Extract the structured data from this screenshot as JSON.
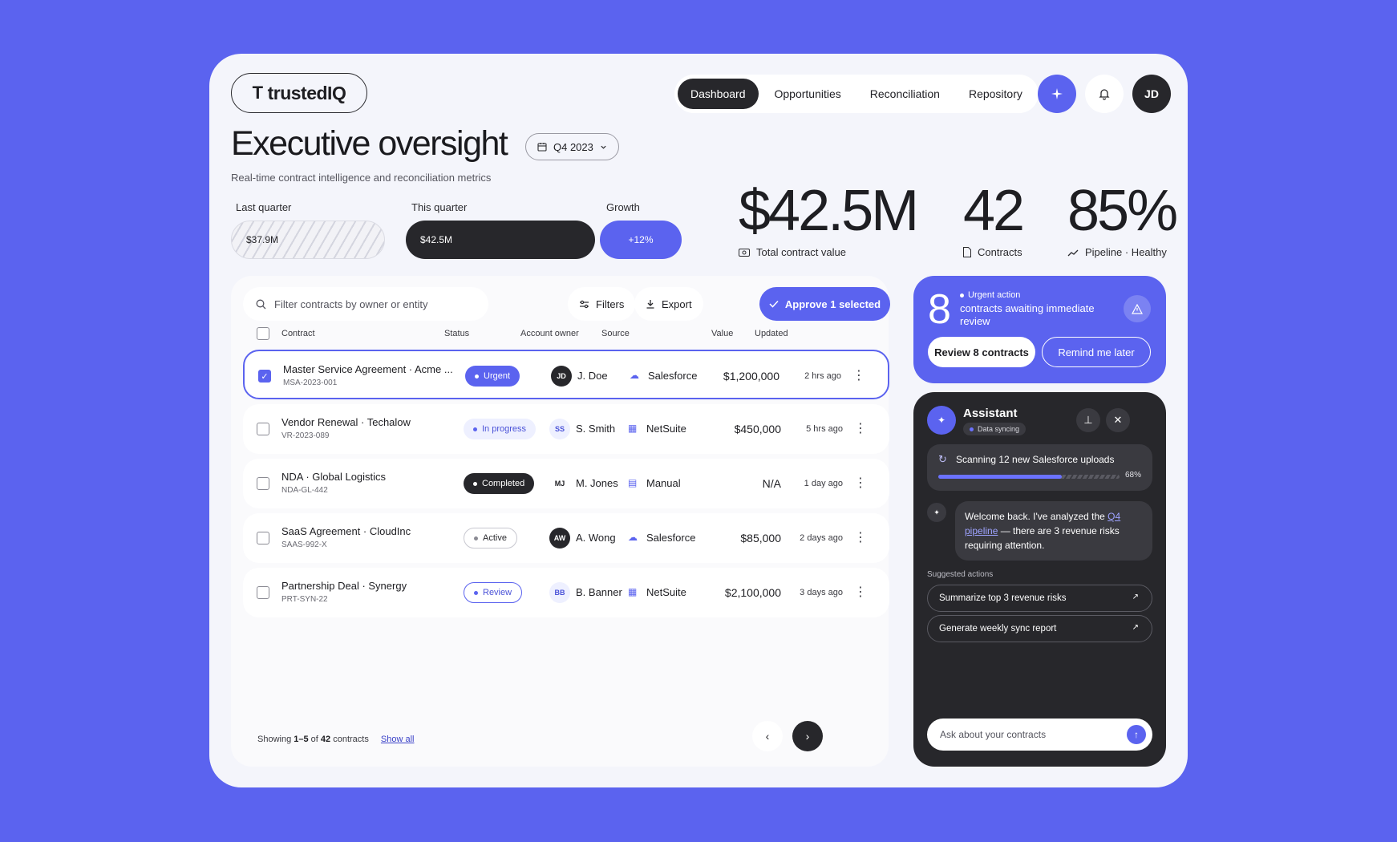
{
  "brand": {
    "logo_mark": "T",
    "logo_text": "trustedIQ"
  },
  "nav": {
    "items": [
      "Dashboard",
      "Opportunities",
      "Reconciliation",
      "Repository"
    ],
    "active": "Dashboard"
  },
  "header": {
    "avatar_initials": "JD"
  },
  "page": {
    "title": "Executive oversight",
    "quarter": "Q4 2023",
    "subtitle": "Real-time contract intelligence and reconciliation metrics"
  },
  "comparison": {
    "last_label": "Last quarter",
    "last_value": "$37.9M",
    "this_label": "This quarter",
    "this_value": "$42.5M",
    "growth_label": "Growth",
    "growth_value": "+12%"
  },
  "stats": {
    "total_value": "$42.5M",
    "total_label": "Total contract value",
    "contracts": "42",
    "contracts_label": "Contracts",
    "pipeline": "85%",
    "pipeline_label": "Pipeline · Healthy"
  },
  "table": {
    "search_placeholder": "Filter contracts by owner or entity",
    "filters_label": "Filters",
    "export_label": "Export",
    "approve_label": "Approve 1 selected",
    "columns": {
      "contract": "Contract",
      "status": "Status",
      "owner": "Account owner",
      "source": "Source",
      "value": "Value",
      "updated": "Updated"
    },
    "rows": [
      {
        "name": "Master Service Agreement · Acme ...",
        "code": "MSA-2023-001",
        "status": "Urgent",
        "owner_initials": "JD",
        "owner": "J. Doe",
        "source": "Salesforce",
        "value": "$1,200,000",
        "updated": "2 hrs ago"
      },
      {
        "name": "Vendor Renewal · Techalow",
        "code": "VR-2023-089",
        "status": "In progress",
        "owner_initials": "SS",
        "owner": "S. Smith",
        "source": "NetSuite",
        "value": "$450,000",
        "updated": "5 hrs ago"
      },
      {
        "name": "NDA · Global Logistics",
        "code": "NDA-GL-442",
        "status": "Completed",
        "owner_initials": "MJ",
        "owner": "M. Jones",
        "source": "Manual",
        "value": "N/A",
        "updated": "1 day ago"
      },
      {
        "name": "SaaS Agreement · CloudInc",
        "code": "SAAS-992-X",
        "status": "Active",
        "owner_initials": "AW",
        "owner": "A. Wong",
        "source": "Salesforce",
        "value": "$85,000",
        "updated": "2 days ago"
      },
      {
        "name": "Partnership Deal · Synergy",
        "code": "PRT-SYN-22",
        "status": "Review",
        "owner_initials": "BB",
        "owner": "B. Banner",
        "source": "NetSuite",
        "value": "$2,100,000",
        "updated": "3 days ago"
      }
    ],
    "pager": {
      "prefix": "Showing ",
      "range": "1–5",
      "mid": " of ",
      "total": "42",
      "suffix": " contracts",
      "show_all": "Show all"
    }
  },
  "urgent": {
    "count": "8",
    "tag": "Urgent action",
    "text": "contracts awaiting immediate review",
    "review_label": "Review 8 contracts",
    "remind_label": "Remind me later"
  },
  "assistant": {
    "title": "Assistant",
    "status": "Data syncing",
    "scan_text": "Scanning 12 new Salesforce uploads",
    "scan_progress": 68,
    "scan_pct": "68%",
    "message_pre": "Welcome back. I've analyzed the ",
    "message_link": "Q4 pipeline",
    "message_post": " — there are 3 revenue risks requiring attention.",
    "suggested_label": "Suggested actions",
    "suggestions": [
      "Summarize top 3 revenue risks",
      "Generate weekly sync report"
    ],
    "ask_placeholder": "Ask about your contracts"
  },
  "colors": {
    "accent": "#5b63ef",
    "dark": "#27272b",
    "background": "#5b63ef"
  }
}
